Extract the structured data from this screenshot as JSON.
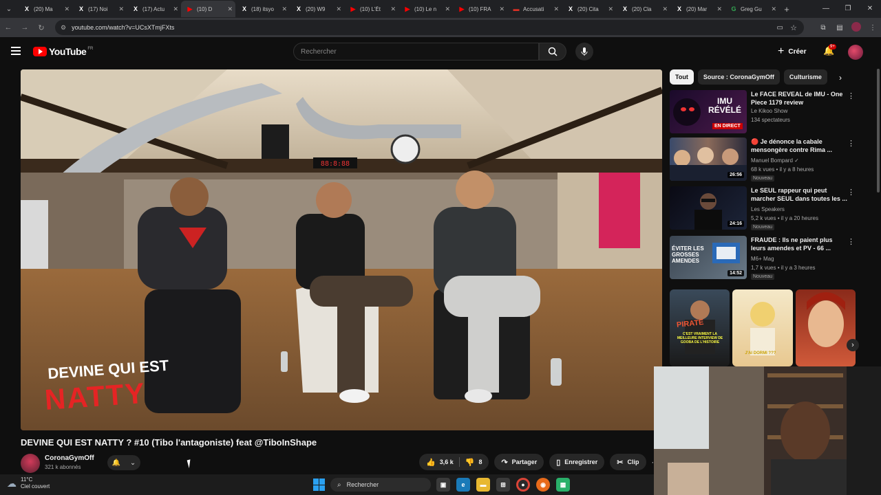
{
  "browser": {
    "tabs": [
      {
        "title": "(20) Ma",
        "icon": "x-icon",
        "color": "#ffffff",
        "glyph": "X"
      },
      {
        "title": "(17) Noi",
        "icon": "x-icon",
        "color": "#ffffff",
        "glyph": "X"
      },
      {
        "title": "(17) Actu",
        "icon": "x-icon",
        "color": "#ffffff",
        "glyph": "X"
      },
      {
        "title": "(10) D",
        "icon": "youtube-icon",
        "color": "#ff0000",
        "glyph": "▶",
        "active": true
      },
      {
        "title": "(18) itsyo",
        "icon": "x-icon",
        "color": "#ffffff",
        "glyph": "X"
      },
      {
        "title": "(20) W9",
        "icon": "x-icon",
        "color": "#ffffff",
        "glyph": "X"
      },
      {
        "title": "(10) L'Ét",
        "icon": "youtube-icon",
        "color": "#ff0000",
        "glyph": "▶"
      },
      {
        "title": "(10) Le n",
        "icon": "youtube-icon",
        "color": "#ff0000",
        "glyph": "▶"
      },
      {
        "title": "(10) FRA",
        "icon": "youtube-icon",
        "color": "#ff0000",
        "glyph": "▶"
      },
      {
        "title": "Accusati",
        "icon": "news-icon",
        "color": "#d93025",
        "glyph": "▬"
      },
      {
        "title": "(20) Cita",
        "icon": "x-icon",
        "color": "#ffffff",
        "glyph": "X"
      },
      {
        "title": "(20) Cla",
        "icon": "x-icon",
        "color": "#ffffff",
        "glyph": "X"
      },
      {
        "title": "(20) Mar",
        "icon": "x-icon",
        "color": "#ffffff",
        "glyph": "X"
      },
      {
        "title": "Greg Gu",
        "icon": "google-icon",
        "color": "#34a853",
        "glyph": "G"
      }
    ],
    "url": "youtube.com/watch?v=UCsXTmjFXts"
  },
  "youtube": {
    "logo_text": "YouTube",
    "country": "FR",
    "search_placeholder": "Rechercher",
    "create_label": "Créer",
    "notif_badge": "9+"
  },
  "video": {
    "overlay_line1": "DEVINE QUI EST",
    "overlay_line2": "NATTY",
    "clock_text": "88:8:88",
    "title": "DEVINE QUI EST NATTY ? #10 (Tibo l'antagoniste) feat @TiboInShape",
    "channel": "CoronaGymOff",
    "subscribers": "321 k abonnés",
    "likes": "3,6 k",
    "dislikes": "8",
    "share_label": "Partager",
    "save_label": "Enregistrer",
    "clip_label": "Clip"
  },
  "chips": [
    "Tout",
    "Source : CoronaGymOff",
    "Culturisme"
  ],
  "recommendations": [
    {
      "title": "Le FACE REVEAL de IMU - One Piece 1179 review",
      "channel": "Le Kikoo Show",
      "meta": "134 spectateurs",
      "duration": "",
      "badge": "",
      "live_label": "EN DIRECT",
      "thumb_text": "IMU RÉVÉLÉ"
    },
    {
      "title": "🔴 Je dénonce la cabale mensongère contre Rima ...",
      "channel": "Manuel Bompard ✓",
      "meta": "68 k vues • il y a 8 heures",
      "duration": "26:56",
      "badge": "Nouveau"
    },
    {
      "title": "Le SEUL rappeur qui peut marcher SEUL dans toutes les ...",
      "channel": "Les Speakers",
      "meta": "5,2 k vues • il y a 20 heures",
      "duration": "24:16",
      "badge": "Nouveau"
    },
    {
      "title": "FRAUDE : Ils ne paient plus leurs amendes et PV - 66 ...",
      "channel": "M6+ Mag",
      "meta": "1,7 k vues • il y a 3 heures",
      "duration": "14:52",
      "badge": "Nouveau",
      "thumb_text": "ÉVITER LES GROSSES AMENDES"
    }
  ],
  "shorts": [
    {
      "caption": "PIRATE",
      "sub": "C'EST VRAIMENT LA MEILLEURE INTERVIEW DE GOOBA DE L'HISTOIRE"
    },
    {
      "caption": "J'AI DORMI ???",
      "sub": ""
    },
    {
      "caption": "",
      "sub": ""
    }
  ],
  "taskbar": {
    "temp": "11°C",
    "weather": "Ciel couvert",
    "search": "Rechercher"
  }
}
